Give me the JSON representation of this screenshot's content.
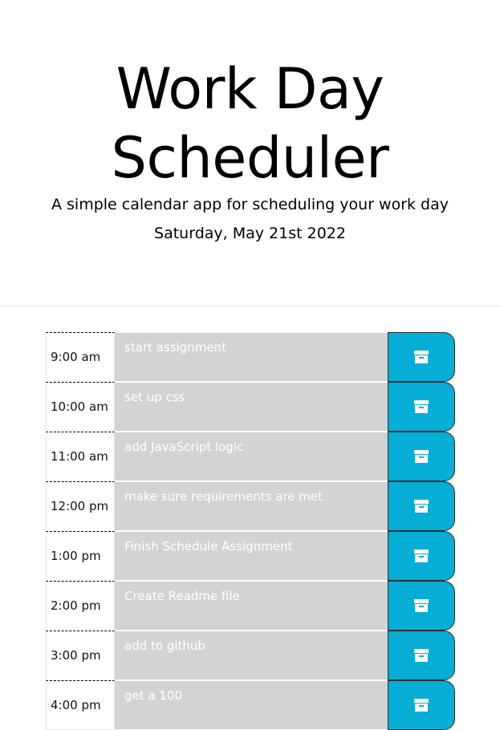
{
  "header": {
    "title": "Work Day Scheduler",
    "lead": "A simple calendar app for scheduling your work day",
    "current_day": "Saturday, May 21st 2022"
  },
  "colors": {
    "save_button": "#06aed5",
    "description_bg": "#d3d3d3"
  },
  "icons": {
    "save": "save-icon"
  },
  "time_blocks": [
    {
      "hour": "9:00 am",
      "text": "start assignment"
    },
    {
      "hour": "10:00 am",
      "text": "set up css"
    },
    {
      "hour": "11:00 am",
      "text": "add JavaScript logic"
    },
    {
      "hour": "12:00 pm",
      "text": "make sure requirements are met"
    },
    {
      "hour": "1:00 pm",
      "text": "Finish Schedule Assignment"
    },
    {
      "hour": "2:00 pm",
      "text": "Create Readme file"
    },
    {
      "hour": "3:00 pm",
      "text": "add to github"
    },
    {
      "hour": "4:00 pm",
      "text": "get a 100"
    }
  ]
}
